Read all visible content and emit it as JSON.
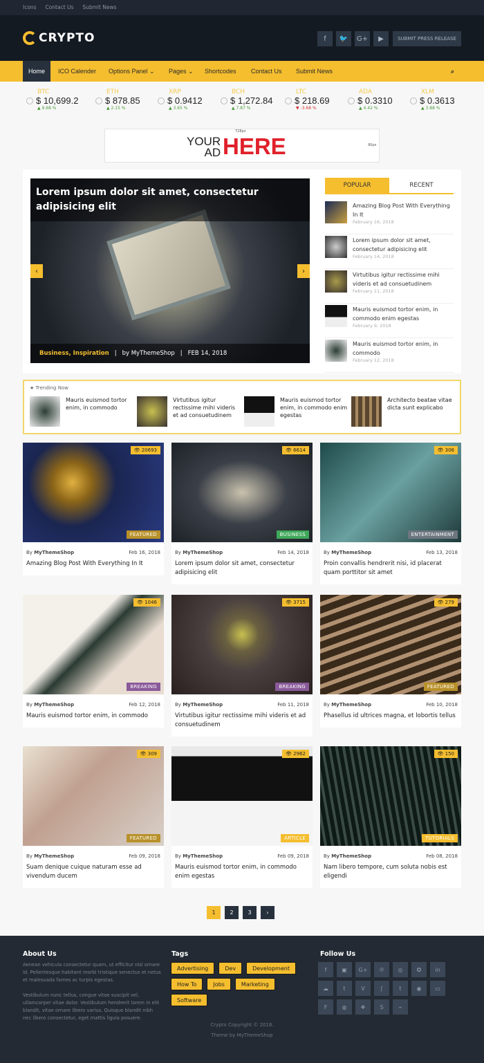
{
  "topbar": {
    "links": [
      "Icons",
      "Contact Us",
      "Submit News"
    ]
  },
  "header": {
    "logo": "CRYPTO",
    "social": [
      "f",
      "t",
      "G+",
      "yt"
    ],
    "press_button": "SUBMIT PRESS RELEASE"
  },
  "nav": {
    "items": [
      "Home",
      "ICO Calender",
      "Options Panel ⌄",
      "Pages ⌄",
      "Shortcodes",
      "Contact Us",
      "Submit News"
    ],
    "search_icon": "search-icon"
  },
  "ticker": [
    {
      "symbol": "BTC",
      "price": "$ 10,699.2",
      "change": "9.68 %",
      "dir": "up"
    },
    {
      "symbol": "ETH",
      "price": "$ 878.85",
      "change": "2.15 %",
      "dir": "up"
    },
    {
      "symbol": "XRP",
      "price": "$ 0.9412",
      "change": "3.65 %",
      "dir": "up"
    },
    {
      "symbol": "BCH",
      "price": "$ 1,272.84",
      "change": "7.87 %",
      "dir": "up"
    },
    {
      "symbol": "LTC",
      "price": "$ 218.69",
      "change": "-3.68 %",
      "dir": "down"
    },
    {
      "symbol": "ADA",
      "price": "$ 0.3310",
      "change": "4.42 %",
      "dir": "up"
    },
    {
      "symbol": "XLM",
      "price": "$ 0.3613",
      "change": "3.88 %",
      "dir": "up"
    }
  ],
  "ad": {
    "your": "YOUR",
    "ad": "AD",
    "here": "HERE",
    "width_label": "728px",
    "height_label": "90px"
  },
  "slider": {
    "title": "Lorem ipsum dolor sit amet, consectetur adipisicing elit",
    "categories": "Business, Inspiration",
    "author": "by MyThemeShop",
    "date": "FEB 14, 2018"
  },
  "sidebar": {
    "tabs": [
      "POPULAR",
      "RECENT"
    ],
    "posts": [
      {
        "title": "Amazing Blog Post With Everything In It",
        "date": "February 16, 2018"
      },
      {
        "title": "Lorem ipsum dolor sit amet, consectetur adipisicing elit",
        "date": "February 14, 2018"
      },
      {
        "title": "Virtutibus igitur rectissime mihi videris et ad consuetudinem",
        "date": "February 11, 2018"
      },
      {
        "title": "Mauris euismod tortor enim, in commodo enim egestas",
        "date": "February 9, 2018"
      },
      {
        "title": "Mauris euismod tortor enim, in commodo",
        "date": "February 12, 2018"
      }
    ]
  },
  "trending": {
    "label": "★ Trending Now",
    "items": [
      "Mauris euismod tortor enim, in commodo",
      "Virtutibus igitur rectissime mihi videris et ad consuetudinem",
      "Mauris euismod tortor enim, in commodo enim egestas",
      "Architecto beatae vitae dicta sunt explicabo"
    ]
  },
  "posts": [
    {
      "views": "20693",
      "category": "FEATURED",
      "cat_color": "#b8912a",
      "author": "MyThemeShop",
      "date": "Feb 16, 2018",
      "title": "Amazing Blog Post With Everything In It"
    },
    {
      "views": "6614",
      "category": "BUSINESS",
      "cat_color": "#3fa85a",
      "author": "MyThemeShop",
      "date": "Feb 14, 2018",
      "title": "Lorem ipsum dolor sit amet, consectetur adipisicing elit"
    },
    {
      "views": "306",
      "category": "ENTERTAINMENT",
      "cat_color": "#6d7680",
      "author": "MyThemeShop",
      "date": "Feb 13, 2018",
      "title": "Proin convallis hendrerit nisi, id placerat quam porttitor sit amet"
    },
    {
      "views": "1046",
      "category": "BREAKING",
      "cat_color": "#8a5a9a",
      "author": "MyThemeShop",
      "date": "Feb 12, 2018",
      "title": "Mauris euismod tortor enim, in commodo"
    },
    {
      "views": "3715",
      "category": "BREAKING",
      "cat_color": "#8a5a9a",
      "author": "MyThemeShop",
      "date": "Feb 11, 2018",
      "title": "Virtutibus igitur rectissime mihi videris et ad consuetudinem"
    },
    {
      "views": "279",
      "category": "FEATURED",
      "cat_color": "#b8912a",
      "author": "MyThemeShop",
      "date": "Feb 10, 2018",
      "title": "Phasellus id ultrices magna, et lobortis tellus"
    },
    {
      "views": "309",
      "category": "FEATURED",
      "cat_color": "#b8912a",
      "author": "MyThemeShop",
      "date": "Feb 09, 2018",
      "title": "Suam denique cuique naturam esse ad vivendum ducem"
    },
    {
      "views": "2962",
      "category": "ARTICLE",
      "cat_color": "#f5be2f",
      "author": "MyThemeShop",
      "date": "Feb 09, 2018",
      "title": "Mauris euismod tortor enim, in commodo enim egestas"
    },
    {
      "views": "150",
      "category": "TUTORIALS",
      "cat_color": "#f5be2f",
      "author": "MyThemeShop",
      "date": "Feb 08, 2018",
      "title": "Nam libero tempore, cum soluta nobis est eligendi"
    }
  ],
  "by_label": "By",
  "pagination": [
    "1",
    "2",
    "3",
    "›"
  ],
  "footer": {
    "about_title": "About Us",
    "about_p1": "Aenean vehicula consectetur quam, ut efficitur nisl ornare id. Pellentesque habitant morbi tristique senectus et netus et malesuada fames ac turpis egestas.",
    "about_p2": "Vestibulum nunc tellus, congue vitae suscipit vel, ullamcorper vitae dolor. Vestibulum hendrerit lorem in elit blandit, vitae ornare libero varius. Quisque blandit nibh nec libero consectetur, eget mattis ligula posuere.",
    "tags_title": "Tags",
    "tags": [
      "Advertising",
      "Dev",
      "Development",
      "How To",
      "Jobs",
      "Marketing",
      "Software"
    ],
    "follow_title": "Follow Us",
    "social": [
      "f",
      "▣",
      "G+",
      "℗",
      "◎",
      "✪",
      "in",
      "☁",
      "t",
      "V",
      "ʃ",
      "t",
      "◉",
      "▭",
      "F",
      "◍",
      "❖",
      "S",
      "⌁"
    ],
    "copyright": "Crypto Copyright © 2018.",
    "theme": "Theme by MyThemeShop"
  },
  "colors": {
    "accent": "#f5be2f",
    "dark": "#141a22",
    "footer": "#232a33"
  }
}
